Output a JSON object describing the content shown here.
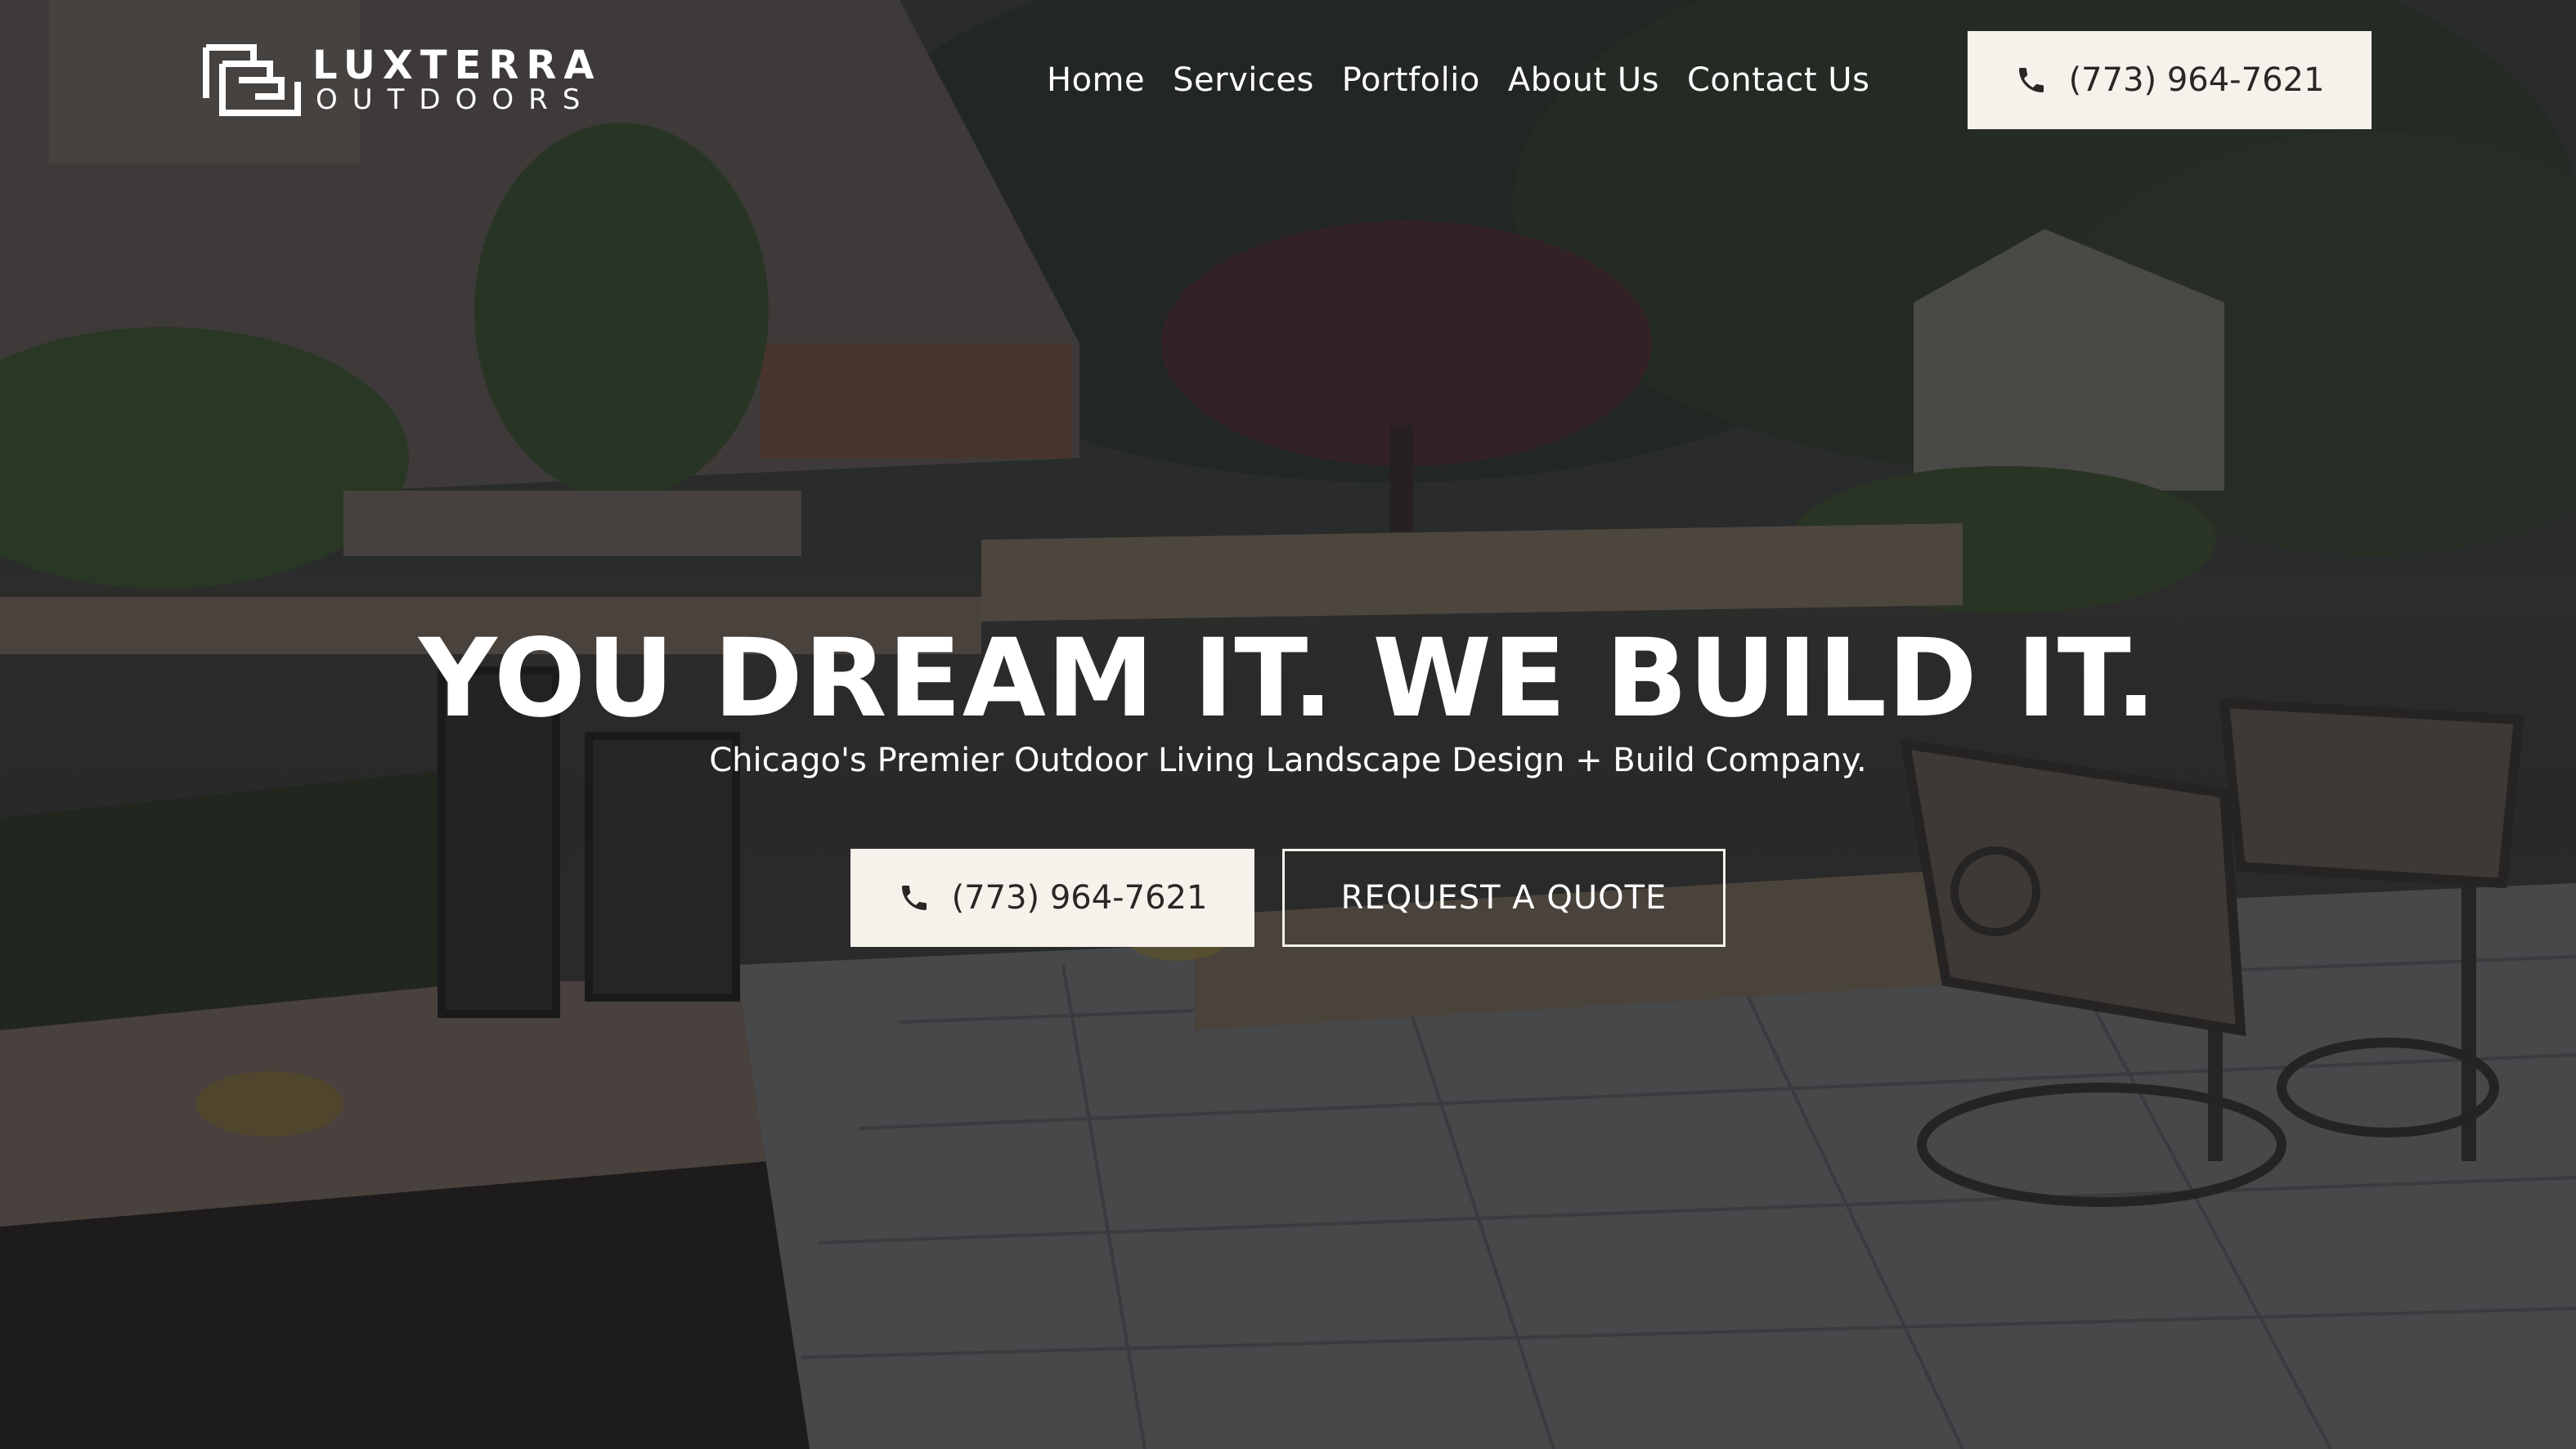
{
  "brand": {
    "name_line1": "LUXTERRA",
    "name_line2": "OUTDOORS"
  },
  "nav": {
    "items": [
      {
        "label": "Home"
      },
      {
        "label": "Services"
      },
      {
        "label": "Portfolio"
      },
      {
        "label": "About Us"
      },
      {
        "label": "Contact Us"
      }
    ],
    "phone_label": "(773) 964-7621"
  },
  "hero": {
    "headline": "YOU DREAM IT. WE BUILD IT.",
    "subheadline": "Chicago's Premier Outdoor Living Landscape Design + Build Company.",
    "phone_button_label": "(773) 964-7621",
    "quote_button_label": "REQUEST A QUOTE",
    "background_image": "backyard-patio-photo"
  },
  "colors": {
    "button_bg": "#f6f1ea",
    "button_text": "#2a2623",
    "text": "#ffffff"
  },
  "icons": [
    "logo-mark-icon",
    "phone-icon"
  ]
}
